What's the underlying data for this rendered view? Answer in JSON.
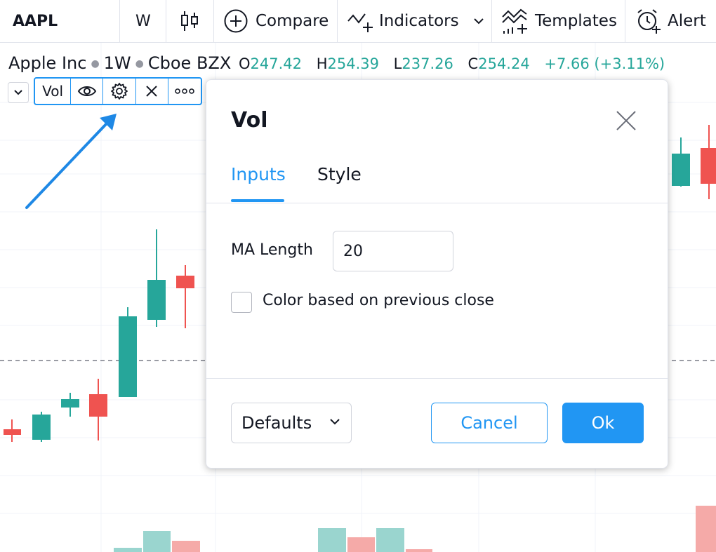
{
  "toolbar": {
    "symbol": "AAPL",
    "interval": "W",
    "compare_label": "Compare",
    "indicators_label": "Indicators",
    "templates_label": "Templates",
    "alert_label": "Alert"
  },
  "legend": {
    "name": "Apple Inc",
    "interval": "1W",
    "exchange": "Cboe BZX",
    "open_label": "O",
    "open": "247.42",
    "high_label": "H",
    "high": "254.39",
    "low_label": "L",
    "low": "237.26",
    "close_label": "C",
    "close": "254.24",
    "change": "+7.66 (+3.11%)"
  },
  "indicator_legend": {
    "name": "Vol"
  },
  "dialog": {
    "title": "Vol",
    "tabs": [
      {
        "label": "Inputs",
        "active": true
      },
      {
        "label": "Style",
        "active": false
      }
    ],
    "ma_length_label": "MA Length",
    "ma_length_value": "20",
    "color_checkbox_label": "Color based on previous close",
    "color_checkbox_checked": false,
    "defaults_label": "Defaults",
    "cancel_label": "Cancel",
    "ok_label": "Ok"
  },
  "colors": {
    "up": "#26a69a",
    "down": "#ef5350",
    "accent": "#2196f3",
    "volume_up": "#9ad5cf",
    "volume_down": "#f5aaa8"
  }
}
